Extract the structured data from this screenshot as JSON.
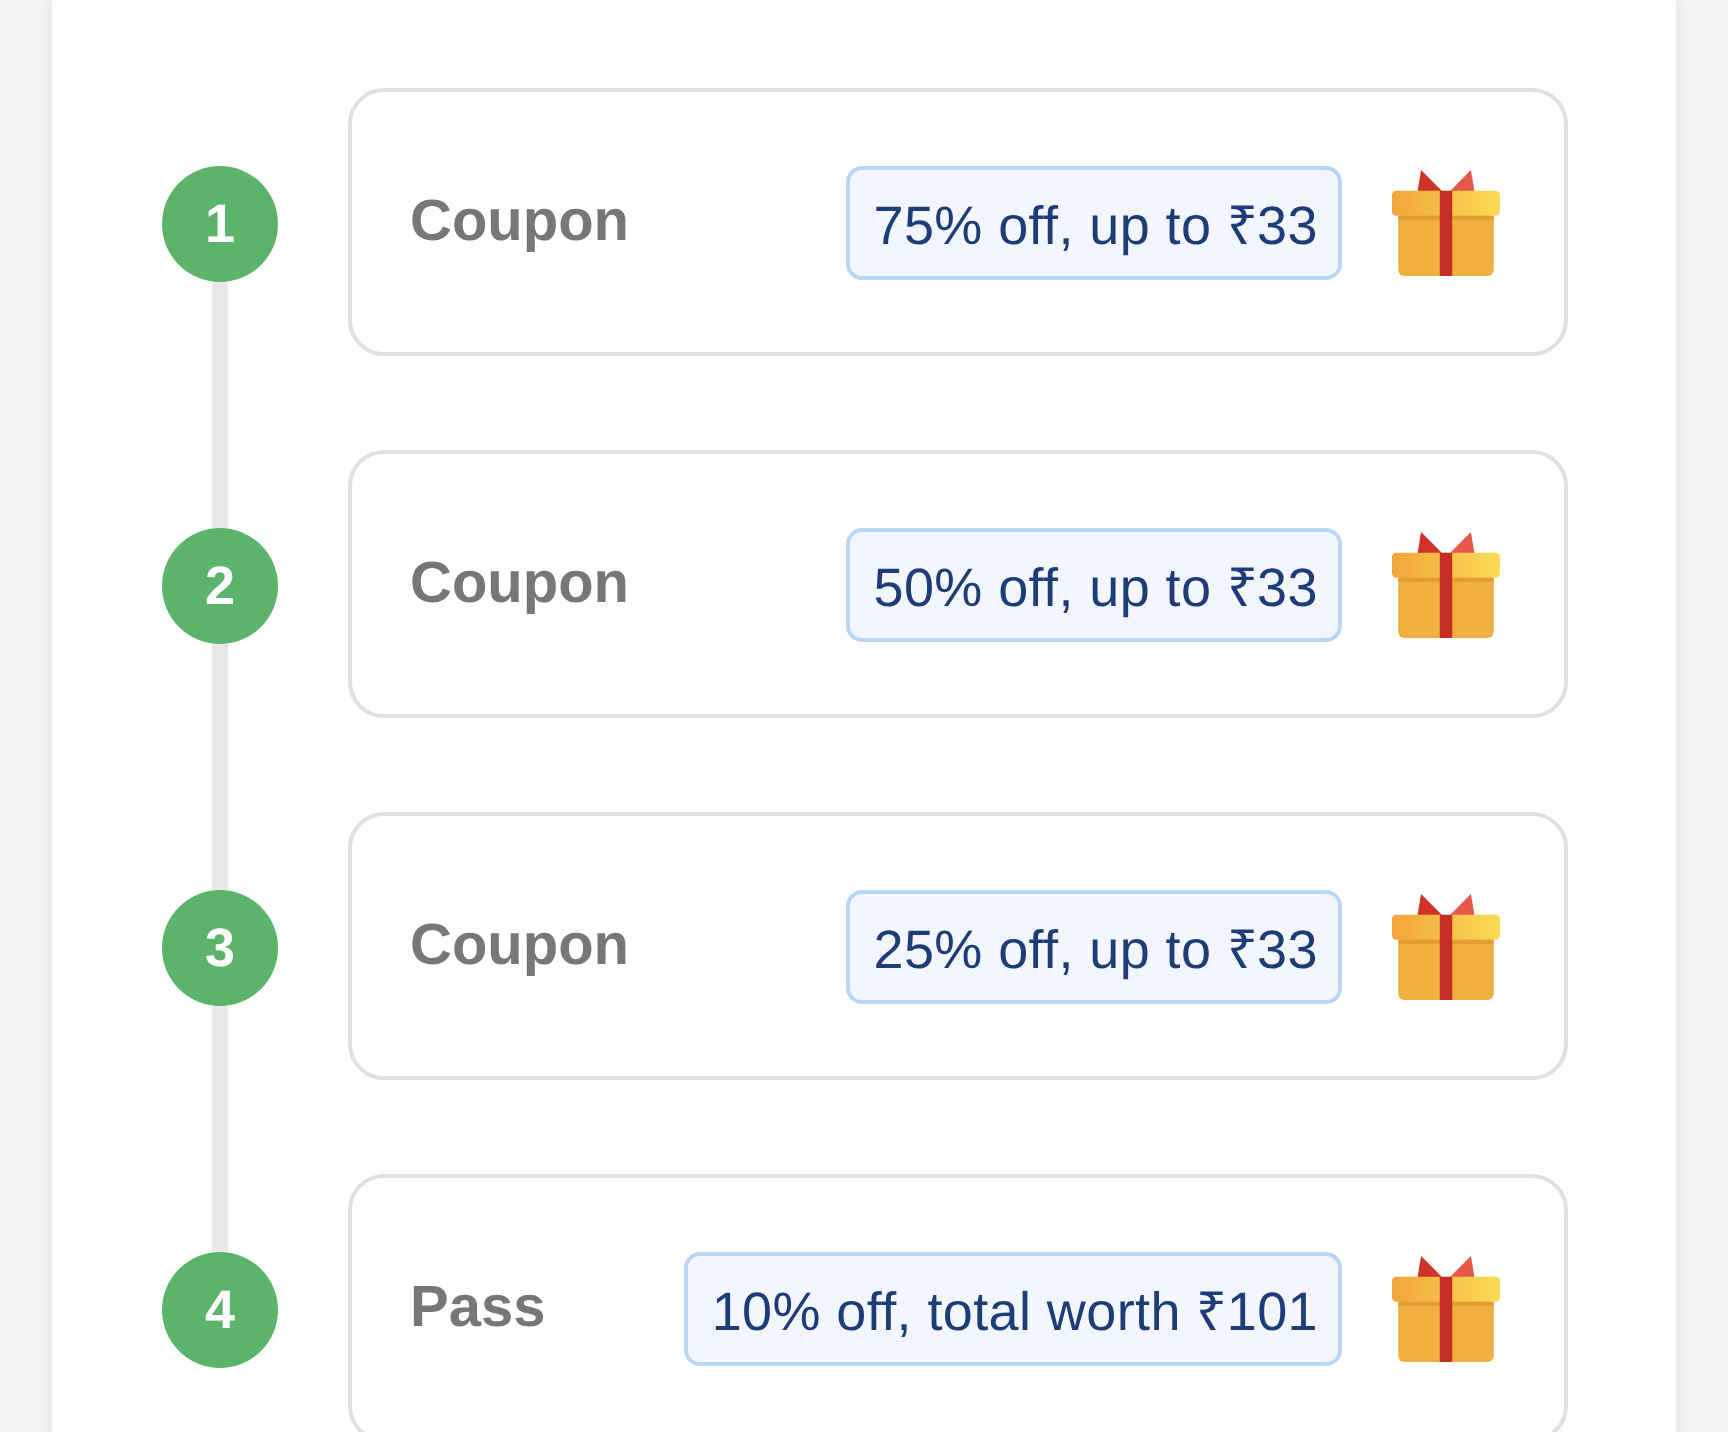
{
  "steps": [
    {
      "number": "1",
      "label": "Coupon",
      "offer": "75% off, up to ₹33"
    },
    {
      "number": "2",
      "label": "Coupon",
      "offer": "50% off, up to ₹33"
    },
    {
      "number": "3",
      "label": "Coupon",
      "offer": "25% off, up to ₹33"
    },
    {
      "number": "4",
      "label": "Pass",
      "offer": "10% off, total worth ₹101"
    }
  ]
}
